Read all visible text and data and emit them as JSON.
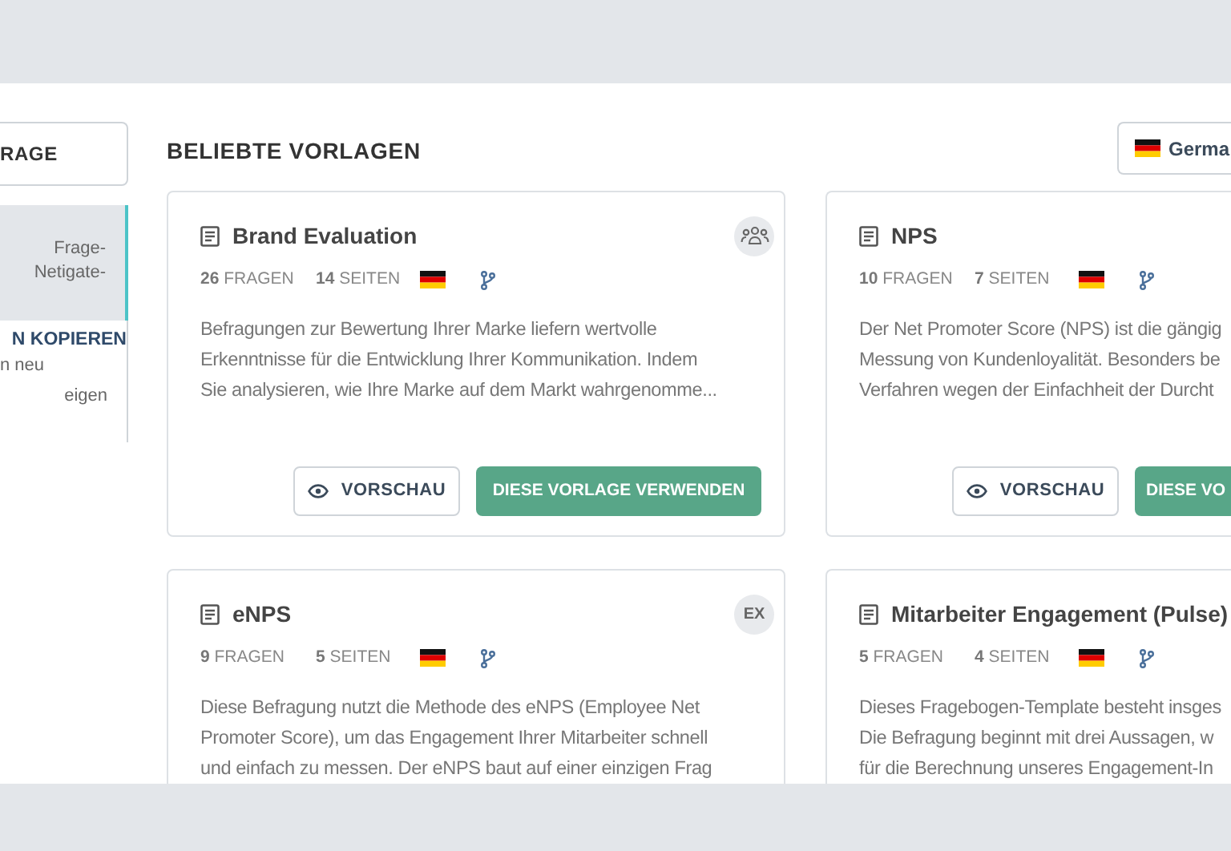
{
  "sidebar": {
    "button": "RAGE",
    "items": [
      {
        "selected": true,
        "lines": [
          "Frage-",
          "Netigate-"
        ]
      },
      {
        "selected": false,
        "title": "N KOPIEREN",
        "lines": [
          "n neu"
        ]
      },
      {
        "selected": false,
        "lines": [
          "eigen"
        ]
      }
    ]
  },
  "section_title": "BELIEBTE VORLAGEN",
  "language_button": "Germa",
  "cards": [
    {
      "title": "Brand Evaluation",
      "badge": {
        "kind": "people"
      },
      "questions": "26",
      "questions_label": "FRAGEN",
      "pages": "14",
      "pages_label": "SEITEN",
      "lines": [
        "Befragungen zur Bewertung Ihrer Marke liefern wertvolle",
        "Erkenntnisse für die Entwicklung Ihrer Kommunikation. Indem",
        "Sie analysieren, wie Ihre Marke auf dem Markt wahrgenomme..."
      ],
      "preview": "VORSCHAU",
      "use": "DIESE VORLAGE VERWENDEN"
    },
    {
      "title": "NPS",
      "questions": "10",
      "questions_label": "FRAGEN",
      "pages": "7",
      "pages_label": "SEITEN",
      "lines": [
        "Der Net Promoter Score (NPS) ist die gängig",
        "Messung von Kundenloyalität. Besonders be",
        "Verfahren wegen der Einfachheit der Durcht"
      ],
      "preview": "VORSCHAU",
      "use": "DIESE VO"
    },
    {
      "title": "eNPS",
      "badge": {
        "kind": "text",
        "text": "EX"
      },
      "questions": "9",
      "questions_label": "FRAGEN",
      "pages": "5",
      "pages_label": "SEITEN",
      "lines": [
        "Diese Befragung nutzt die Methode des eNPS (Employee Net",
        "Promoter Score), um das Engagement Ihrer Mitarbeiter schnell",
        "und einfach zu messen. Der eNPS baut auf einer einzigen Frag"
      ]
    },
    {
      "title": "Mitarbeiter Engagement (Pulse)",
      "questions": "5",
      "questions_label": "FRAGEN",
      "pages": "4",
      "pages_label": "SEITEN",
      "lines": [
        "Dieses Fragebogen-Template besteht insges",
        "Die Befragung beginnt mit drei Aussagen, w",
        "für die Berechnung unseres Engagement-In"
      ]
    }
  ]
}
